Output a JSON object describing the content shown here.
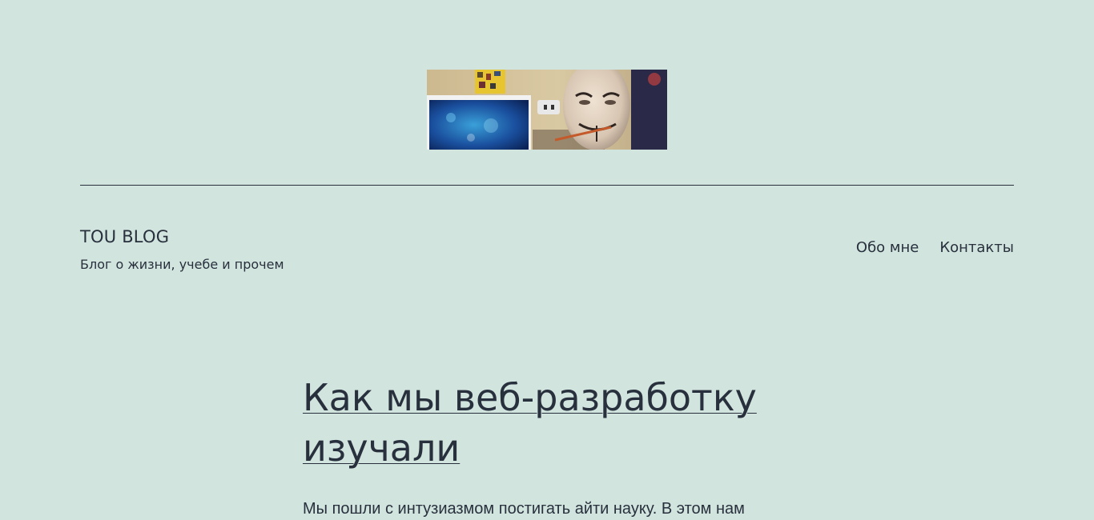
{
  "header": {
    "image_alt": "header image: person in Guy Fawkes mask next to an aquarium screen"
  },
  "site": {
    "title": "TOU BLOG",
    "description": "Блог о жизни, учебе и прочем"
  },
  "nav": {
    "items": [
      {
        "label": "Обо мне"
      },
      {
        "label": "Контакты"
      }
    ]
  },
  "post": {
    "title": "Как мы веб-разработку изучали",
    "excerpt": "Мы пошли с интузиазмом постигать айти науку. В этом нам"
  },
  "colors": {
    "background": "#d1e4dd",
    "text": "#28303d"
  }
}
